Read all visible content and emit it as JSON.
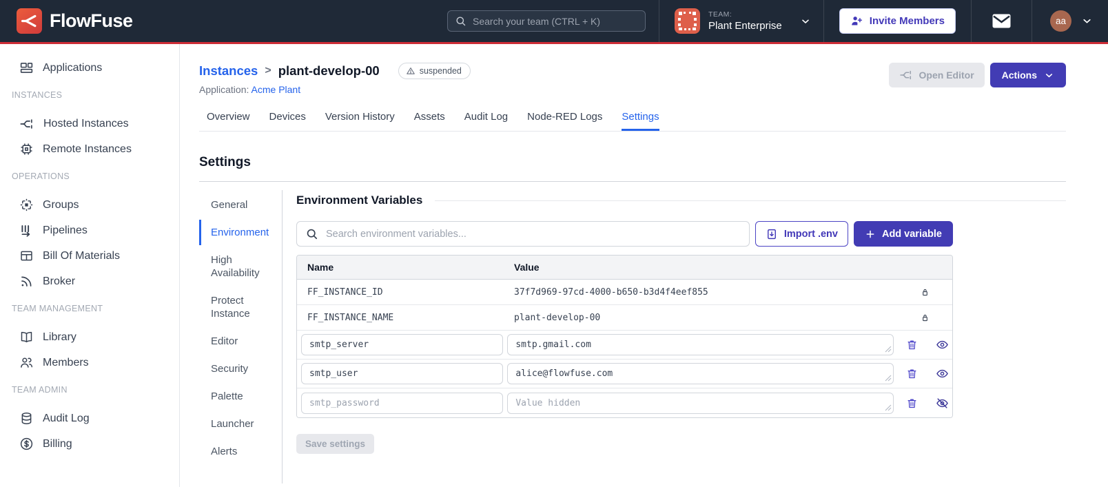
{
  "colors": {
    "brand_red": "#CD2D37",
    "navbar_bg": "#1F2937",
    "primary_indigo": "#423CB4",
    "link_blue": "#2563EB"
  },
  "navbar": {
    "brand": "FlowFuse",
    "search_placeholder": "Search your team (CTRL + K)",
    "team_label": "TEAM:",
    "team_name": "Plant Enterprise",
    "invite_button": "Invite Members",
    "avatar_initials": "aa"
  },
  "sidebar": {
    "items": [
      {
        "label": "Applications"
      },
      {
        "label": "Hosted Instances"
      },
      {
        "label": "Remote Instances"
      },
      {
        "label": "Groups"
      },
      {
        "label": "Pipelines"
      },
      {
        "label": "Bill Of Materials"
      },
      {
        "label": "Broker"
      },
      {
        "label": "Library"
      },
      {
        "label": "Members"
      },
      {
        "label": "Audit Log"
      },
      {
        "label": "Billing"
      }
    ],
    "sections": [
      {
        "label": "INSTANCES"
      },
      {
        "label": "OPERATIONS"
      },
      {
        "label": "TEAM MANAGEMENT"
      },
      {
        "label": "TEAM ADMIN"
      }
    ]
  },
  "header": {
    "breadcrumb_root": "Instances",
    "breadcrumb_separator": ">",
    "instance_name": "plant-develop-00",
    "status_badge": "suspended",
    "application_label": "Application:",
    "application_name": "Acme Plant",
    "open_editor_button": "Open Editor",
    "actions_button": "Actions"
  },
  "tabs": [
    {
      "label": "Overview"
    },
    {
      "label": "Devices"
    },
    {
      "label": "Version History"
    },
    {
      "label": "Assets"
    },
    {
      "label": "Audit Log"
    },
    {
      "label": "Node-RED Logs"
    },
    {
      "label": "Settings",
      "active": true
    }
  ],
  "settings": {
    "title": "Settings",
    "nav": [
      {
        "label": "General"
      },
      {
        "label": "Environment",
        "active": true
      },
      {
        "label": "High Availability"
      },
      {
        "label": "Protect Instance"
      },
      {
        "label": "Editor"
      },
      {
        "label": "Security"
      },
      {
        "label": "Palette"
      },
      {
        "label": "Launcher"
      },
      {
        "label": "Alerts"
      }
    ],
    "env": {
      "title": "Environment Variables",
      "search_placeholder": "Search environment variables...",
      "import_button": "Import .env",
      "add_button": "Add variable",
      "columns": [
        {
          "label": "Name"
        },
        {
          "label": "Value"
        }
      ],
      "locked_rows": [
        {
          "name": "FF_INSTANCE_ID",
          "value": "37f7d969-97cd-4000-b650-b3d4f4eef855"
        },
        {
          "name": "FF_INSTANCE_NAME",
          "value": "plant-develop-00"
        }
      ],
      "editable_rows": [
        {
          "name": "smtp_server",
          "value": "smtp.gmail.com"
        },
        {
          "name": "smtp_user",
          "value": "alice@flowfuse.com"
        },
        {
          "name": "smtp_password",
          "value": "",
          "value_placeholder": "Value hidden"
        }
      ],
      "save_button": "Save settings"
    }
  }
}
